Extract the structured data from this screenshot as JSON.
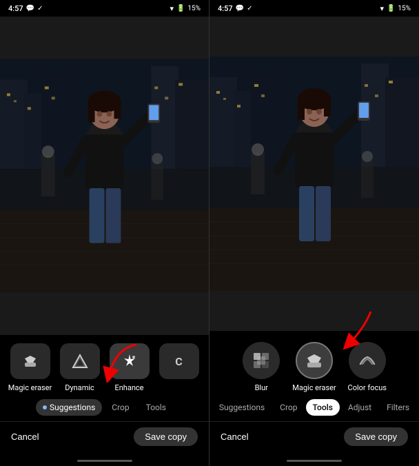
{
  "left_panel": {
    "status": {
      "time": "4:57",
      "battery": "15%"
    },
    "tabs": [
      {
        "id": "suggestions",
        "label": "Suggestions",
        "active": true,
        "has_dot": true
      },
      {
        "id": "crop",
        "label": "Crop",
        "active": false
      },
      {
        "id": "tools",
        "label": "Tools",
        "active": false
      }
    ],
    "tools": [
      {
        "id": "magic-eraser",
        "label": "Magic eraser",
        "icon": "✏"
      },
      {
        "id": "dynamic",
        "label": "Dynamic",
        "icon": "△"
      },
      {
        "id": "enhance",
        "label": "Enhance",
        "icon": "✦"
      },
      {
        "id": "more",
        "label": "C",
        "icon": "C"
      }
    ],
    "cancel_label": "Cancel",
    "save_label": "Save copy"
  },
  "right_panel": {
    "status": {
      "time": "4:57",
      "battery": "15%"
    },
    "tabs": [
      {
        "id": "suggestions",
        "label": "Suggestions",
        "active": false,
        "has_dot": false
      },
      {
        "id": "crop",
        "label": "Crop",
        "active": false
      },
      {
        "id": "tools",
        "label": "Tools",
        "active": true
      },
      {
        "id": "adjust",
        "label": "Adjust",
        "active": false
      },
      {
        "id": "filters",
        "label": "Filters",
        "active": false
      }
    ],
    "tools": [
      {
        "id": "blur",
        "label": "Blur",
        "icon": "⊞"
      },
      {
        "id": "magic-eraser",
        "label": "Magic eraser",
        "icon": "✏",
        "selected": true
      },
      {
        "id": "color-focus",
        "label": "Color focus",
        "icon": "◒"
      }
    ],
    "cancel_label": "Cancel",
    "save_label": "Save copy"
  },
  "icons": {
    "wifi": "▲",
    "battery_low": "▭"
  }
}
